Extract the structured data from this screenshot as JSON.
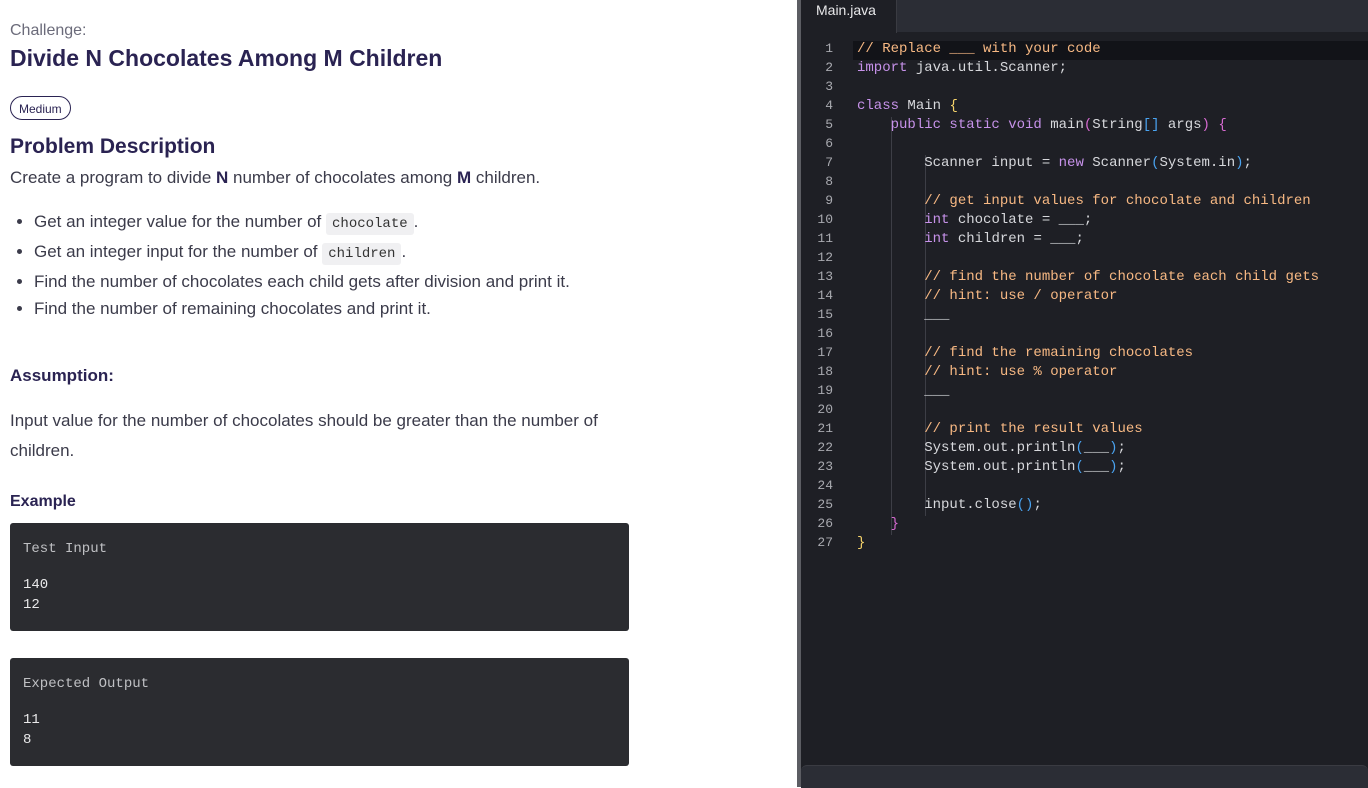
{
  "challenge": {
    "label": "Challenge:",
    "title": "Divide N Chocolates Among M Children",
    "difficulty": "Medium"
  },
  "problem": {
    "heading": "Problem Description",
    "intro_pre": "Create a program to divide ",
    "intro_n": "N",
    "intro_mid": " number of chocolates among ",
    "intro_m": "M",
    "intro_post": " children.",
    "bullets": [
      {
        "pre": "Get an integer value for the number of ",
        "code": "chocolate",
        "post": "."
      },
      {
        "pre": "Get an integer input for the number of ",
        "code": "children",
        "post": "."
      },
      {
        "text": "Find the number of chocolates each child gets after division and print it."
      },
      {
        "text": "Find the number of remaining chocolates and print it."
      }
    ]
  },
  "assumption": {
    "heading": "Assumption:",
    "text": "Input value for the number of chocolates should be greater than the number of children."
  },
  "example": {
    "heading": "Example",
    "input_label": "Test Input",
    "input_lines": [
      "140",
      "12"
    ],
    "output_label": "Expected Output",
    "output_lines": [
      "11",
      "8"
    ]
  },
  "editor": {
    "tab": "Main.java",
    "line_numbers": [
      "1",
      "2",
      "3",
      "4",
      "5",
      "6",
      "7",
      "8",
      "9",
      "10",
      "11",
      "12",
      "13",
      "14",
      "15",
      "16",
      "17",
      "18",
      "19",
      "20",
      "21",
      "22",
      "23",
      "24",
      "25",
      "26",
      "27"
    ]
  },
  "colors": {
    "title": "#2a2352",
    "editor_bg": "#1e1f25",
    "comment": "#f7b883",
    "keyword": "#c792ea",
    "bracket_yellow": "#f5d26a",
    "bracket_magenta": "#d66ad0",
    "bracket_blue": "#4aa3f0"
  }
}
